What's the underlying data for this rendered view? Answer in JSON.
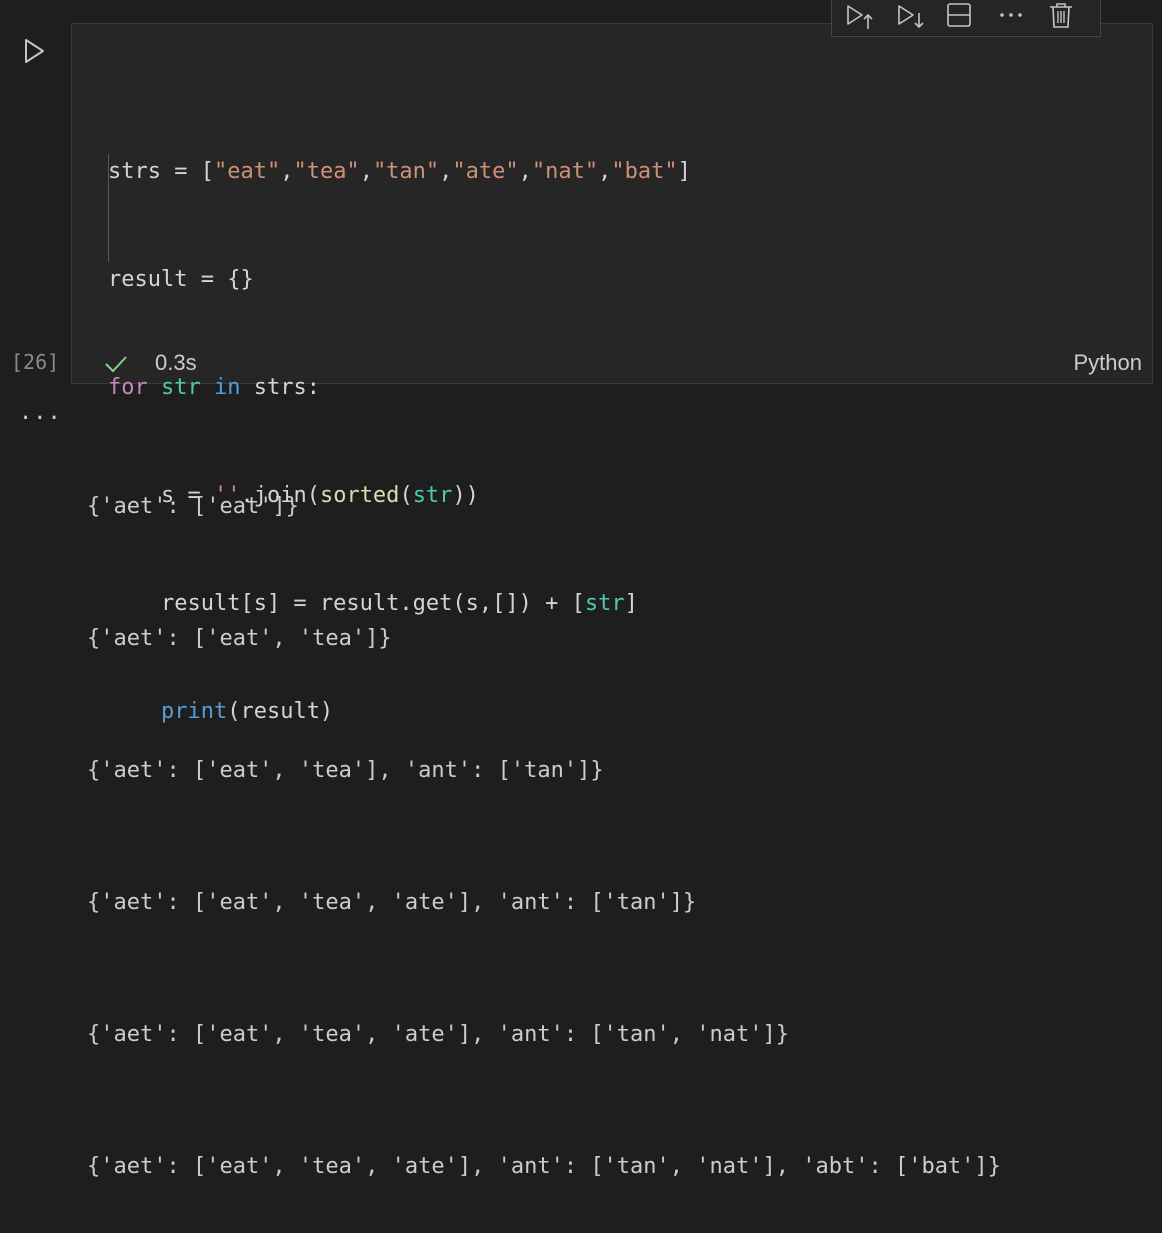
{
  "cell": {
    "execution_count": "[26]",
    "exec_time": "0.3s",
    "language": "Python"
  },
  "toolbar": {
    "buttons": [
      "run-above",
      "run-below",
      "split-cell",
      "more",
      "delete"
    ]
  },
  "code": {
    "line1": {
      "a": "strs = [",
      "s1": "\"eat\"",
      "c1": ",",
      "s2": "\"tea\"",
      "c2": ",",
      "s3": "\"tan\"",
      "c3": ",",
      "s4": "\"ate\"",
      "c4": ",",
      "s5": "\"nat\"",
      "c5": ",",
      "s6": "\"bat\"",
      "b": "]"
    },
    "line2": "result = {}",
    "line3": {
      "kw_for": "for",
      "var": " str ",
      "kw_in": "in",
      "rest": " strs:"
    },
    "line4": {
      "pre": "    s = ",
      "str": "''",
      "mid": ".join(",
      "fn": "sorted",
      "p1": "(",
      "bi": "str",
      "p2": "))"
    },
    "line5": {
      "pre": "    result[s] = result.get(s,[]) + [",
      "bi": "str",
      "post": "]"
    },
    "line6": {
      "pre": "    ",
      "fn": "print",
      "rest": "(result)"
    }
  },
  "output": {
    "more_label": "...",
    "lines": [
      "{'aet': ['eat']}",
      "{'aet': ['eat', 'tea']}",
      "{'aet': ['eat', 'tea'], 'ant': ['tan']}",
      "{'aet': ['eat', 'tea', 'ate'], 'ant': ['tan']}",
      "{'aet': ['eat', 'tea', 'ate'], 'ant': ['tan', 'nat']}",
      "{'aet': ['eat', 'tea', 'ate'], 'ant': ['tan', 'nat'], 'abt': ['bat']}"
    ]
  },
  "colors": {
    "background": "#1e1e1e",
    "cell_background": "#262626",
    "keyword": "#c586c0",
    "builtin": "#4ec9b0",
    "string": "#ce9178",
    "function": "#dcdcaa",
    "check": "#89d185"
  }
}
